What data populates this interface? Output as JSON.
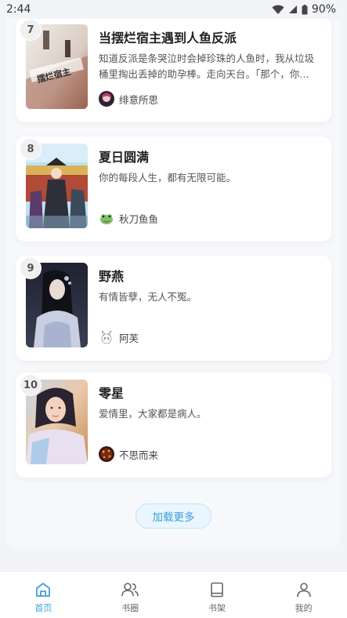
{
  "status_bar": {
    "time": "2:44",
    "battery": "90%"
  },
  "books": [
    {
      "rank": "7",
      "title": "当摆烂宿主遇到人鱼反派",
      "description": "知道反派是条哭泣时会掉珍珠的人鱼时，我从垃圾桶里掏出丢掉的助孕棒。走向天台。「那个，你…",
      "author": "绯意所思",
      "cover_text": "摆烂宿主"
    },
    {
      "rank": "8",
      "title": "夏日圆满",
      "description": "你的每段人生，都有无限可能。",
      "author": "秋刀鱼鱼"
    },
    {
      "rank": "9",
      "title": "野燕",
      "description": "有情皆孽，无人不冤。",
      "author": "阿芙"
    },
    {
      "rank": "10",
      "title": "零星",
      "description": "爱情里，大家都是病人。",
      "author": "不思而来"
    }
  ],
  "load_more_label": "加载更多",
  "tabs": [
    {
      "label": "首页",
      "icon": "home-icon",
      "active": true
    },
    {
      "label": "书圈",
      "icon": "people-icon",
      "active": false
    },
    {
      "label": "书架",
      "icon": "book-icon",
      "active": false
    },
    {
      "label": "我的",
      "icon": "person-icon",
      "active": false
    }
  ],
  "colors": {
    "accent": "#3aa0da",
    "background": "#f2f4f8"
  }
}
